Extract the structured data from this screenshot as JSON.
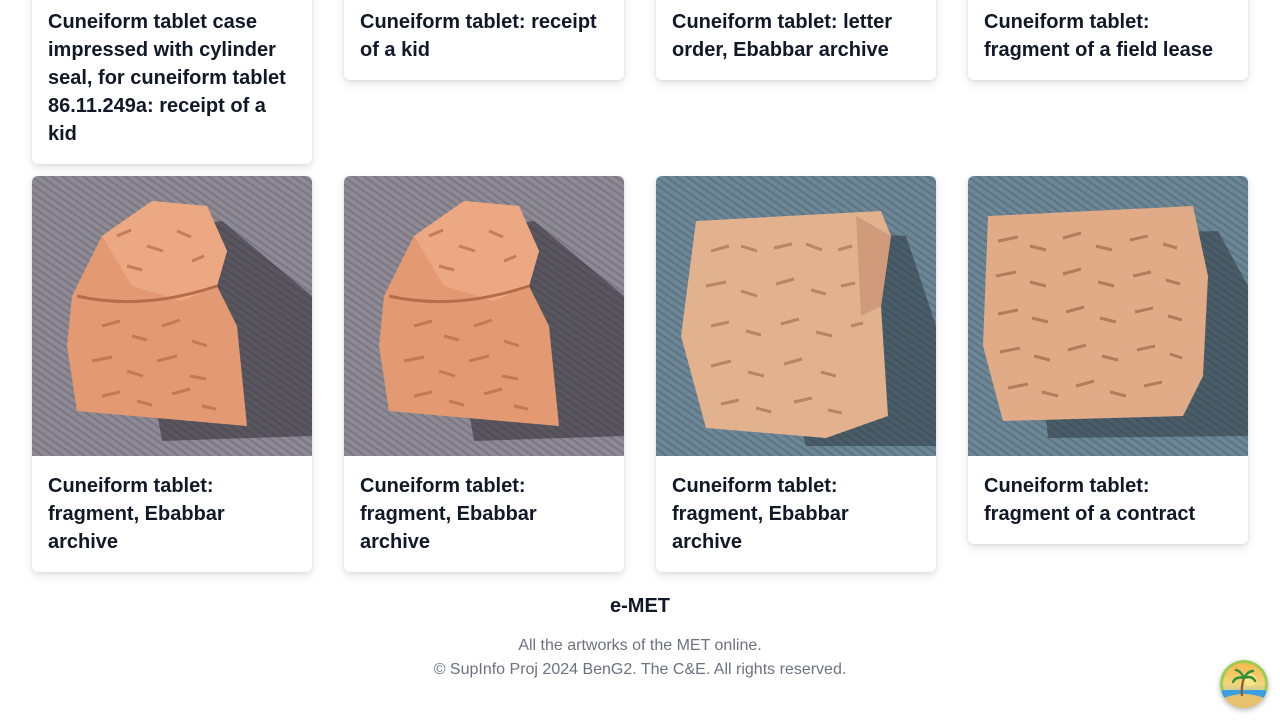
{
  "top_row": [
    {
      "title": "Cuneiform tablet case impressed with cylinder seal, for cuneiform tablet 86.11.249a: receipt of a kid"
    },
    {
      "title": "Cuneiform tablet: receipt of a kid"
    },
    {
      "title": "Cuneiform tablet: letter order, Ebabbar archive"
    },
    {
      "title": "Cuneiform tablet: fragment of a field lease"
    }
  ],
  "bottom_row": [
    {
      "title": "Cuneiform tablet: fragment, Ebabbar archive"
    },
    {
      "title": "Cuneiform tablet: fragment, Ebabbar archive"
    },
    {
      "title": "Cuneiform tablet: fragment, Ebabbar archive"
    },
    {
      "title": "Cuneiform tablet: fragment of a contract"
    }
  ],
  "footer": {
    "brand": "e-MET",
    "tagline": "All the artworks of the MET online.",
    "copyright": "© SupInfo Proj 2024 BenG2. The C&E. All rights reserved."
  },
  "images": {
    "bg_gray": "#8e8a94",
    "bg_blue": "#6d8796",
    "clay_orange": "#e39a72",
    "clay_beige": "#e2b18d"
  },
  "fab": {
    "icon": "beach-island-icon"
  }
}
